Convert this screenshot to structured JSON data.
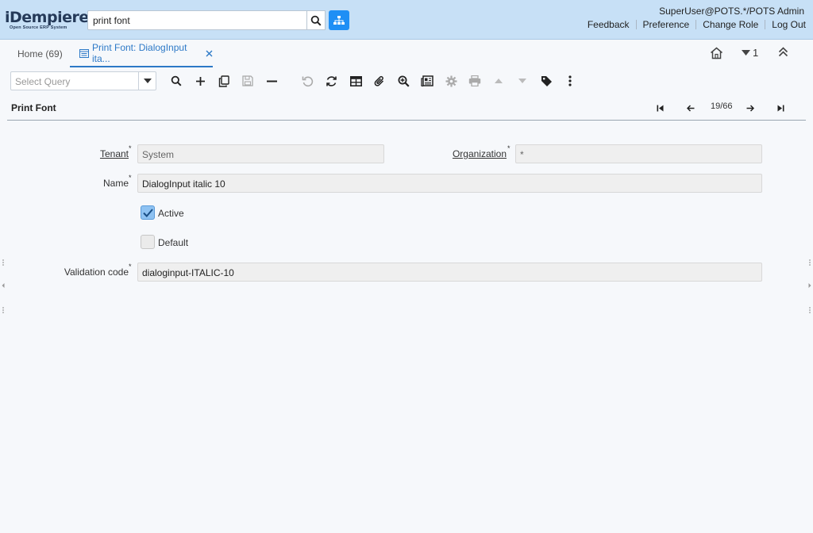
{
  "header": {
    "logo_brand": "iDempiere",
    "logo_tagline": "Open Source ERP System",
    "search_value": "print font",
    "user": "SuperUser@POTS.*/POTS Admin",
    "links": [
      "Feedback",
      "Preference",
      "Change Role",
      "Log Out"
    ]
  },
  "tabs": {
    "home": "Home (69)",
    "active": "Print Font: DialogInput ita...",
    "window_count": "1"
  },
  "toolbar": {
    "query_placeholder": "Select Query"
  },
  "detail": {
    "title": "Print Font",
    "record_counter": "19/66"
  },
  "form": {
    "tenant_label": "Tenant",
    "tenant_value": "System",
    "organization_label": "Organization",
    "organization_value": "*",
    "name_label": "Name",
    "name_value": "DialogInput italic 10",
    "active_label": "Active",
    "active_checked": true,
    "default_label": "Default",
    "default_checked": false,
    "validation_label": "Validation code",
    "validation_value": "dialoginput-ITALIC-10",
    "required_mark": "*"
  },
  "colors": {
    "header_bg": "#c7e0f6",
    "accent": "#2d79c7",
    "menu_button": "#1f8ff5"
  }
}
